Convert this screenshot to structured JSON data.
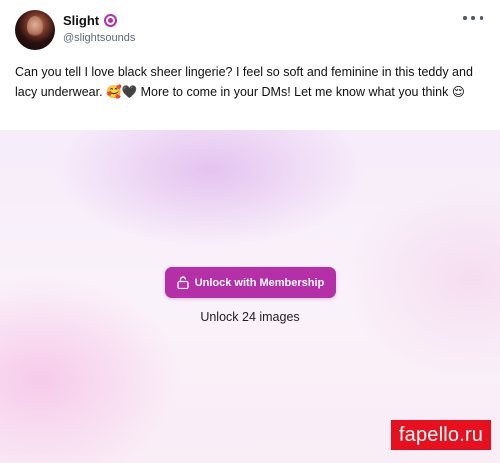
{
  "post": {
    "author": {
      "display_name": "Slight",
      "handle": "@slightsounds",
      "badge_icon": "verified-badge-icon",
      "badge_color": "#b32fb2"
    },
    "menu_icon": "more-horizontal-icon",
    "caption": "Can you tell I love black sheer lingerie? I feel so soft and feminine in this teddy and lacy underwear. 🥰🖤 More to come in your DMs! Let me know what you think 😌"
  },
  "media": {
    "unlock_button_label": "Unlock with Membership",
    "unlock_icon": "unlock-icon",
    "unlock_count_text": "Unlock 24 images",
    "accent_color": "#b42fa8"
  },
  "watermark": {
    "text": "fapello.ru",
    "color": "#e8101e"
  }
}
